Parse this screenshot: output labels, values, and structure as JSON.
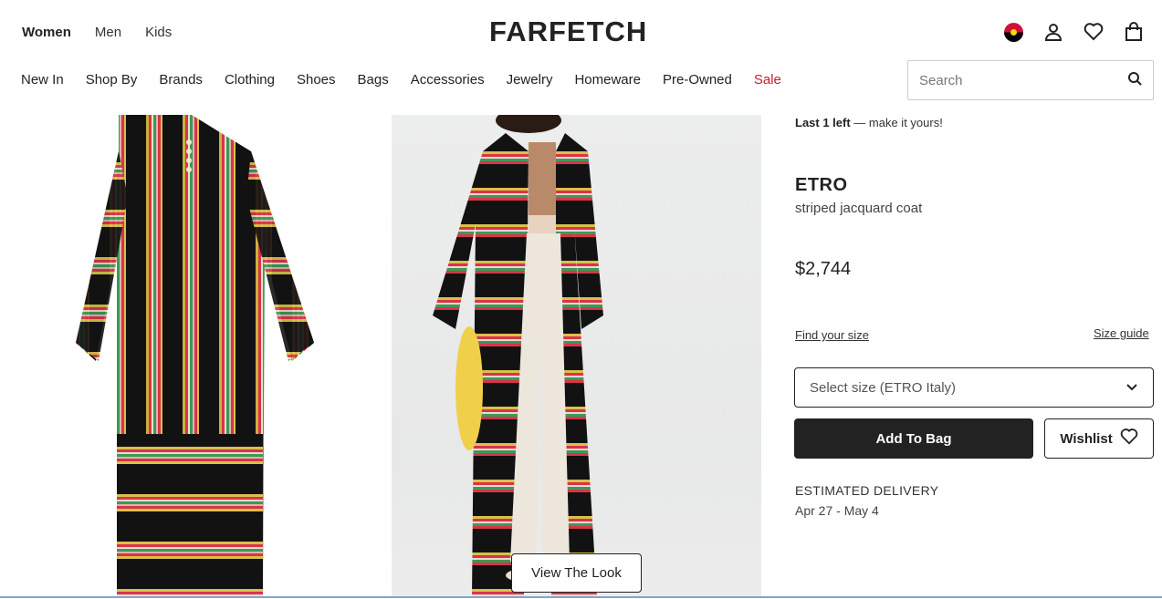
{
  "header": {
    "gender_tabs": [
      "Women",
      "Men",
      "Kids"
    ],
    "logo": "FARFETCH",
    "icons": [
      "flag-icon",
      "account-icon",
      "wishlist-heart-icon",
      "shopping-bag-icon"
    ]
  },
  "nav": {
    "items": [
      "New In",
      "Shop By",
      "Brands",
      "Clothing",
      "Shoes",
      "Bags",
      "Accessories",
      "Jewelry",
      "Homeware",
      "Pre-Owned",
      "Sale"
    ]
  },
  "search": {
    "placeholder": "Search"
  },
  "gallery": {
    "view_look_label": "View The Look"
  },
  "product": {
    "stock_bold": "Last 1 left",
    "stock_rest": " — make it yours!",
    "brand": "ETRO",
    "name": "striped jacquard coat",
    "price": "$2,744",
    "find_size": "Find your size",
    "size_guide": "Size guide",
    "size_select": "Select size (ETRO Italy)",
    "add_to_bag": "Add To Bag",
    "wishlist": "Wishlist",
    "delivery_label": "ESTIMATED DELIVERY",
    "delivery_date": "Apr 27 - May 4"
  },
  "colors": {
    "accent_sale": "#c4202e",
    "primary_button": "#222222"
  }
}
